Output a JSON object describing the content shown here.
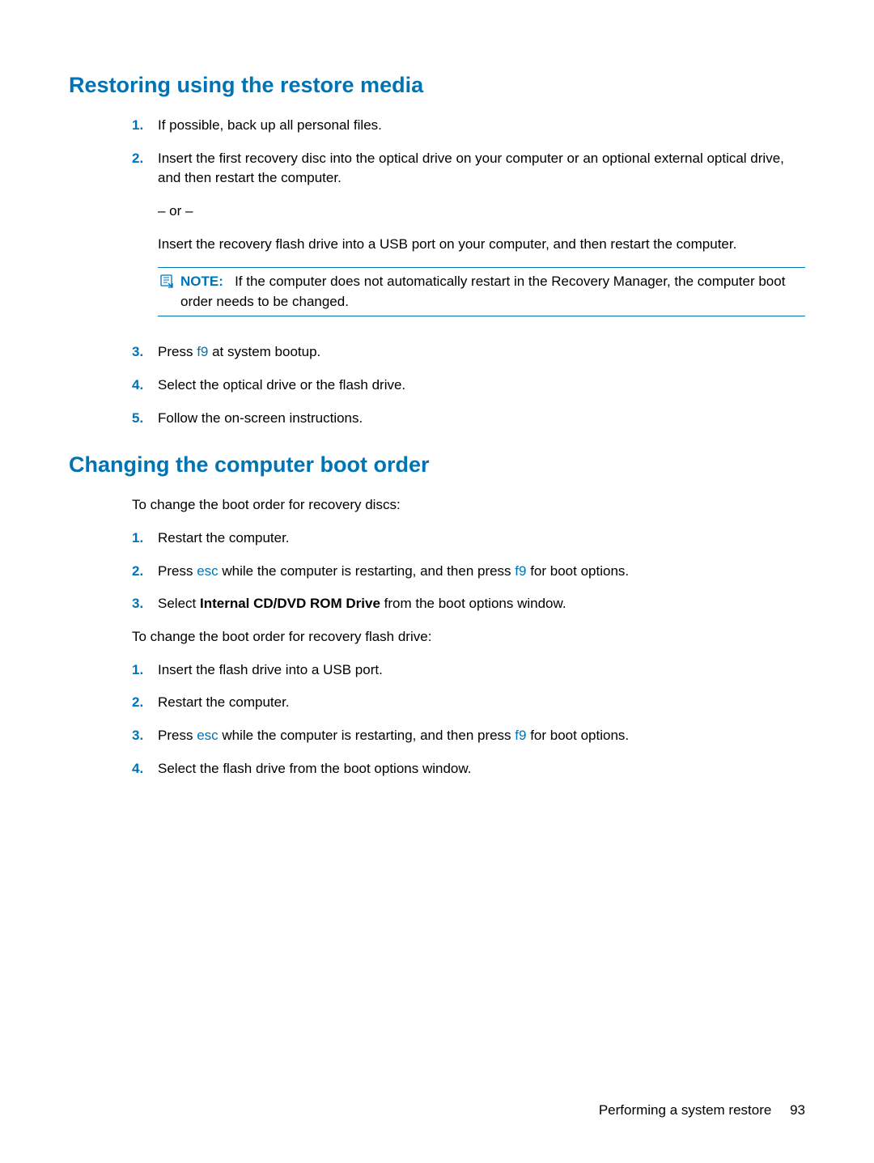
{
  "section1": {
    "heading": "Restoring using the restore media",
    "item1_num": "1.",
    "item1_text": "If possible, back up all personal files.",
    "item2_num": "2.",
    "item2_text": "Insert the first recovery disc into the optical drive on your computer or an optional external optical drive, and then restart the computer.",
    "item2_or": "– or –",
    "item2_alt": "Insert the recovery flash drive into a USB port on your computer, and then restart the computer.",
    "note_label": "NOTE:",
    "note_text": "If the computer does not automatically restart in the Recovery Manager, the computer boot order needs to be changed.",
    "item3_num": "3.",
    "item3_pre": "Press ",
    "item3_key": "f9",
    "item3_post": " at system bootup.",
    "item4_num": "4.",
    "item4_text": "Select the optical drive or the flash drive.",
    "item5_num": "5.",
    "item5_text": "Follow the on-screen instructions."
  },
  "section2": {
    "heading": "Changing the computer boot order",
    "intro1": "To change the boot order for recovery discs:",
    "itemA1_num": "1.",
    "itemA1_text": "Restart the computer.",
    "itemA2_num": "2.",
    "itemA2_pre": "Press ",
    "itemA2_key1": "esc",
    "itemA2_mid": " while the computer is restarting, and then press ",
    "itemA2_key2": "f9",
    "itemA2_post": " for boot options.",
    "itemA3_num": "3.",
    "itemA3_pre": "Select ",
    "itemA3_bold": "Internal CD/DVD ROM Drive",
    "itemA3_post": " from the boot options window.",
    "intro2": "To change the boot order for recovery flash drive:",
    "itemB1_num": "1.",
    "itemB1_text": "Insert the flash drive into a USB port.",
    "itemB2_num": "2.",
    "itemB2_text": "Restart the computer.",
    "itemB3_num": "3.",
    "itemB3_pre": "Press ",
    "itemB3_key1": "esc",
    "itemB3_mid": " while the computer is restarting, and then press ",
    "itemB3_key2": "f9",
    "itemB3_post": " for boot options.",
    "itemB4_num": "4.",
    "itemB4_text": "Select the flash drive from the boot options window."
  },
  "footer": {
    "section_title": "Performing a system restore",
    "page_number": "93"
  }
}
